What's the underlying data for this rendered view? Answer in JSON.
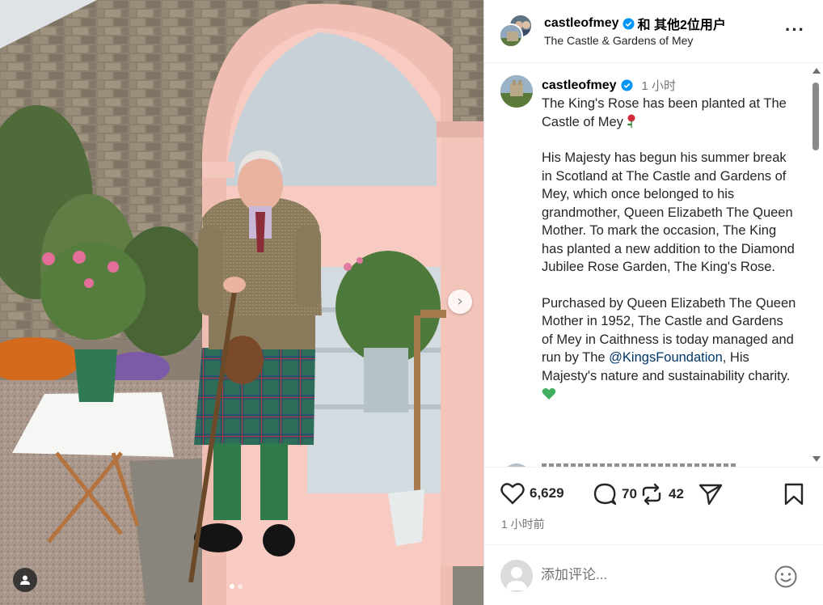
{
  "post": {
    "photo_alt": "King Charles in a kilt standing beside a pink garden arbour with a planted rose",
    "carousel": {
      "current": 1,
      "total": 2
    }
  },
  "header": {
    "username": "castleofmey",
    "collab_suffix": "和 其他2位用户",
    "subtitle": "The Castle & Gardens of Mey",
    "more_icon": "more-horizontal-icon"
  },
  "caption": {
    "username": "castleofmey",
    "time": "1 小时",
    "paragraphs": [
      "The King's Rose has been planted at The Castle of Mey",
      "His Majesty has begun his summer break in Scotland at The Castle and Gardens of Mey, which once belonged to his grandmother, Queen Elizabeth The Queen Mother. To mark the occasion, The King has planted a new addition to the Diamond Jubilee Rose Garden, The King's Rose.",
      "Purchased by Queen Elizabeth The Queen Mother in 1952, The Castle and Gardens of Mey in Caithness is today managed and run by The",
      ", His Majesty's nature and sustainability charity."
    ],
    "mention": "@KingsFoundation",
    "emoji_rose": "rose-emoji",
    "emoji_heart": "green-heart-emoji"
  },
  "actions": {
    "likes": "6,629",
    "comments": "70",
    "reposts": "42",
    "time_ago": "1 小时前"
  },
  "comment": {
    "placeholder": "添加评论..."
  },
  "colors": {
    "verified": "#0095f6",
    "text": "#262626",
    "muted": "#737373",
    "link": "#00376b",
    "border": "#dbdbdb"
  }
}
